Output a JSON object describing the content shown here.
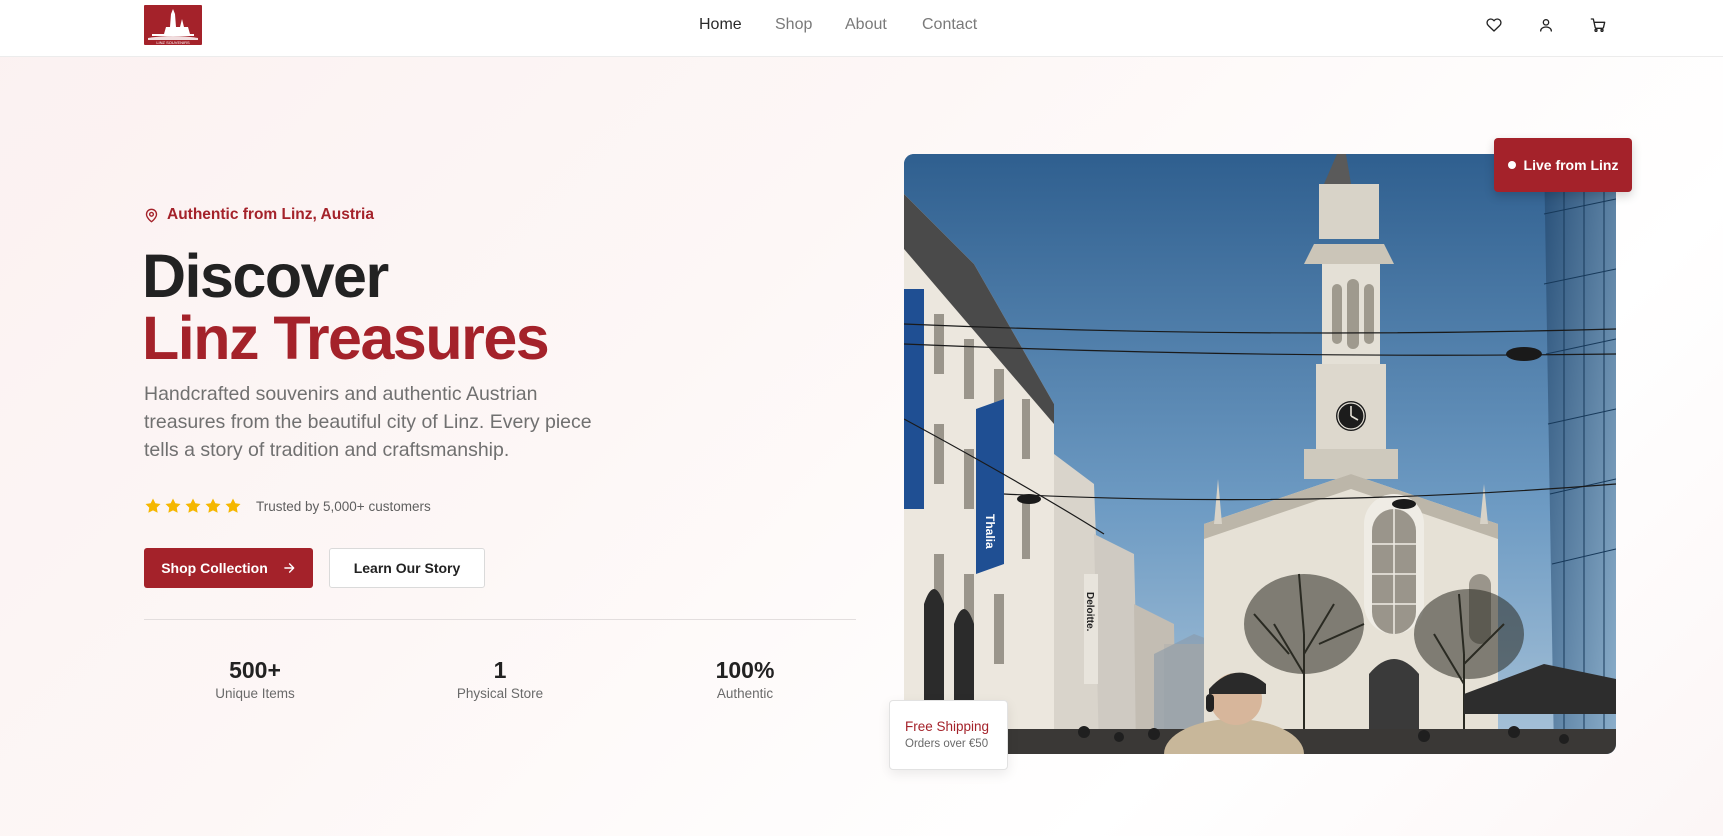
{
  "header": {
    "logo_text": "LINZ SOUVENIRS",
    "nav": [
      {
        "label": "Home",
        "active": true
      },
      {
        "label": "Shop",
        "active": false
      },
      {
        "label": "About",
        "active": false
      },
      {
        "label": "Contact",
        "active": false
      }
    ],
    "icons": [
      "heart-icon",
      "user-icon",
      "cart-icon"
    ]
  },
  "hero": {
    "location_badge": "Authentic from Linz, Austria",
    "title_line1": "Discover",
    "title_line2": "Linz Treasures",
    "description": "Handcrafted souvenirs and authentic Austrian treasures from the beautiful city of Linz. Every piece tells a story of tradition and craftsmanship.",
    "rating_stars": 5,
    "trust_text": "Trusted by 5,000+ customers",
    "primary_button": "Shop Collection",
    "secondary_button": "Learn Our Story",
    "stats": [
      {
        "value": "500+",
        "label": "Unique Items"
      },
      {
        "value": "1",
        "label": "Physical Store"
      },
      {
        "value": "100%",
        "label": "Authentic"
      }
    ]
  },
  "image_card": {
    "live_badge": "Live from Linz",
    "shipping_title": "Free Shipping",
    "shipping_subtitle": "Orders over €50",
    "signs": [
      "Thalia",
      "Deloitte."
    ]
  },
  "colors": {
    "brand": "#a4222a",
    "star": "#f5b700",
    "text_dark": "#222222",
    "text_muted": "#707070"
  }
}
